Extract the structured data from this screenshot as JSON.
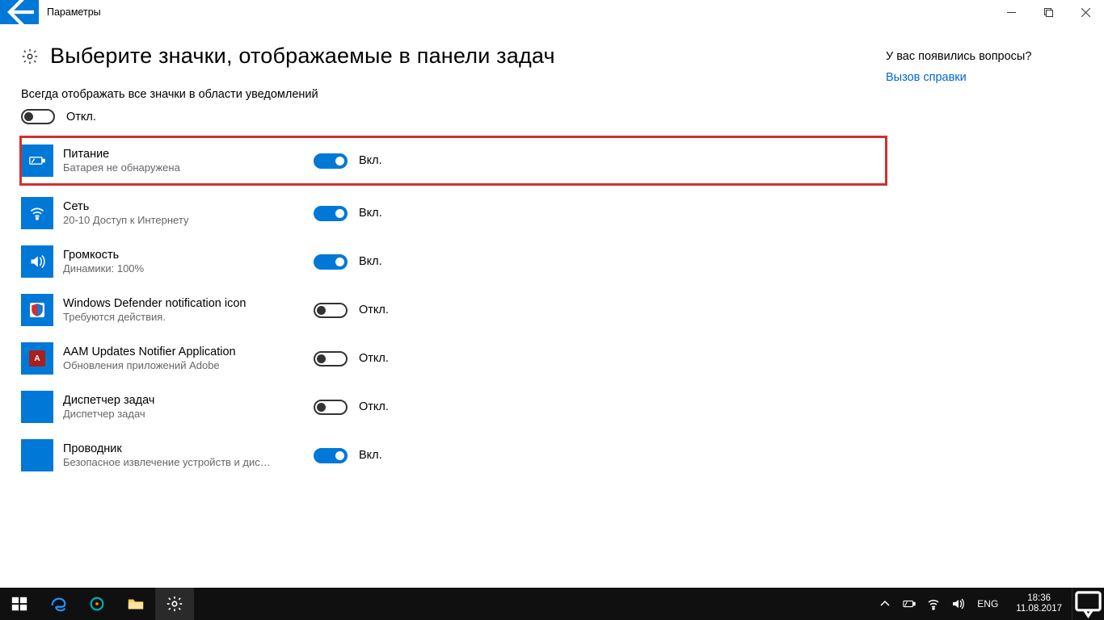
{
  "titlebar": {
    "title": "Параметры"
  },
  "heading": "Выберите значки, отображаемые в панели задач",
  "always_label": "Всегда отображать все значки в области уведомлений",
  "state_on": "Вкл.",
  "state_off": "Откл.",
  "master": {
    "on": false
  },
  "items": [
    {
      "title": "Питание",
      "sub": "Батарея не обнаружена",
      "on": true,
      "highlight": true,
      "icon": "battery"
    },
    {
      "title": "Сеть",
      "sub": "20-10 Доступ к Интернету",
      "on": true,
      "highlight": false,
      "icon": "wifi"
    },
    {
      "title": "Громкость",
      "sub": "Динамики: 100%",
      "on": true,
      "highlight": false,
      "icon": "volume"
    },
    {
      "title": "Windows Defender notification icon",
      "sub": "Требуются действия.",
      "on": false,
      "highlight": false,
      "icon": "defender"
    },
    {
      "title": "AAM Updates Notifier Application",
      "sub": "Обновления приложений Adobe",
      "on": false,
      "highlight": false,
      "icon": "adobe"
    },
    {
      "title": "Диспетчер задач",
      "sub": "Диспетчер задач",
      "on": false,
      "highlight": false,
      "icon": "blank"
    },
    {
      "title": "Проводник",
      "sub": "Безопасное извлечение устройств и дис…",
      "on": true,
      "highlight": false,
      "icon": "blank"
    }
  ],
  "side": {
    "heading": "У вас появились вопросы?",
    "link": "Вызов справки"
  },
  "taskbar": {
    "lang": "ENG",
    "time": "18:36",
    "date": "11.08.2017"
  }
}
